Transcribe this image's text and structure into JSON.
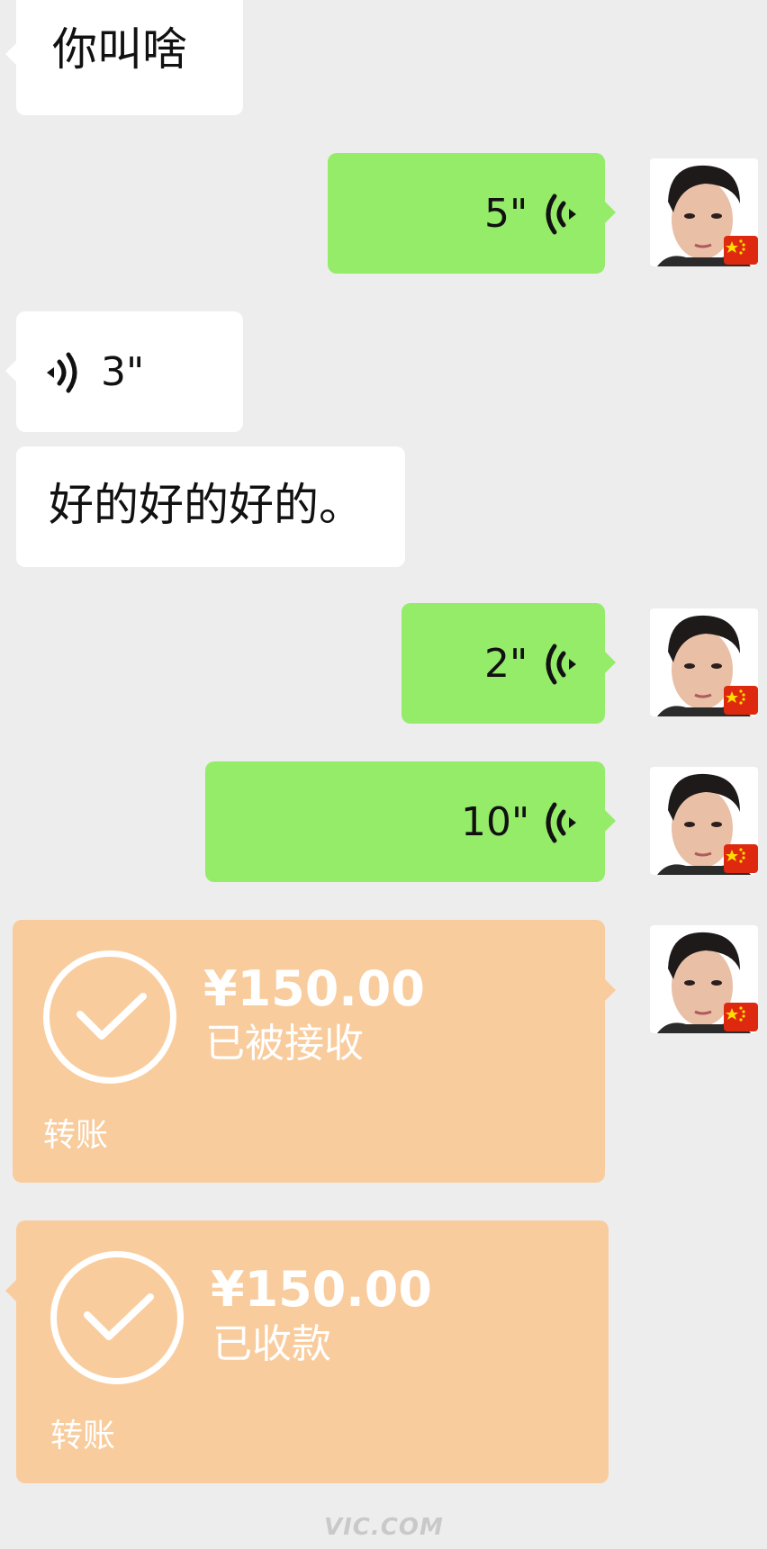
{
  "messages": [
    {
      "side": "left",
      "type": "text",
      "text": "你叫啥"
    },
    {
      "side": "right",
      "type": "voice",
      "duration": "5\""
    },
    {
      "side": "left",
      "type": "voice",
      "duration": "3\""
    },
    {
      "side": "left",
      "type": "text",
      "text": "好的好的好的。"
    },
    {
      "side": "right",
      "type": "voice",
      "duration": "2\""
    },
    {
      "side": "right",
      "type": "voice",
      "duration": "10\""
    }
  ],
  "transfers": [
    {
      "side": "right",
      "amount": "¥150.00",
      "status": "已被接收",
      "label": "转账"
    },
    {
      "side": "left",
      "amount": "¥150.00",
      "status": "已收款",
      "label": "转账"
    }
  ],
  "colors": {
    "background": "#ededed",
    "incoming_bubble": "#ffffff",
    "outgoing_bubble": "#95ec69",
    "transfer_card": "#f9cc9d"
  },
  "icons": {
    "voice": "voice-wave-icon",
    "check": "check-icon",
    "flag": "china-flag-icon",
    "avatar": "avatar"
  },
  "watermark": "VIC.COM"
}
